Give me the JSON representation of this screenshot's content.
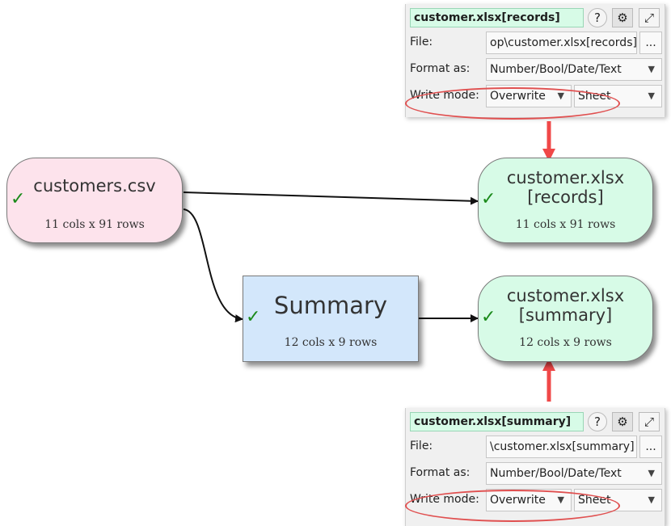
{
  "nodes": {
    "customers_csv": {
      "title": "customers.csv",
      "subtitle": "11 cols x 91 rows",
      "status": "check-icon"
    },
    "records": {
      "title_line1": "customer.xlsx",
      "title_line2": "[records]",
      "subtitle": "11 cols x 91 rows",
      "status": "check-icon"
    },
    "summary": {
      "title": "Summary",
      "subtitle": "12 cols x 9 rows",
      "status": "check-icon"
    },
    "summary_xlsx": {
      "title_line1": "customer.xlsx",
      "title_line2": "[summary]",
      "subtitle": "12 cols x 9 rows",
      "status": "check-icon"
    }
  },
  "check_glyph": "✓",
  "panels": {
    "records": {
      "name": "customer.xlsx[records]",
      "help": "?",
      "settings": "⚙",
      "expand": "⤢",
      "file_label": "File:",
      "file_value": "op\\customer.xlsx[records]",
      "browse": "...",
      "format_label": "Format as:",
      "format_value": "Number/Bool/Date/Text",
      "write_label": "Write mode:",
      "write_value": "Overwrite",
      "target_value": "Sheet"
    },
    "summary": {
      "name": "customer.xlsx[summary]",
      "help": "?",
      "settings": "⚙",
      "expand": "⤢",
      "file_label": "File:",
      "file_value": "\\customer.xlsx[summary]",
      "browse": "...",
      "format_label": "Format as:",
      "format_value": "Number/Bool/Date/Text",
      "write_label": "Write mode:",
      "write_value": "Overwrite",
      "target_value": "Sheet"
    }
  },
  "dropdown_glyph": "▼",
  "colors": {
    "source": "#fde3ec",
    "output": "#d7fbe7",
    "transform": "#d3e7fb",
    "highlight": "#f04848",
    "check": "#1a8a1a"
  }
}
